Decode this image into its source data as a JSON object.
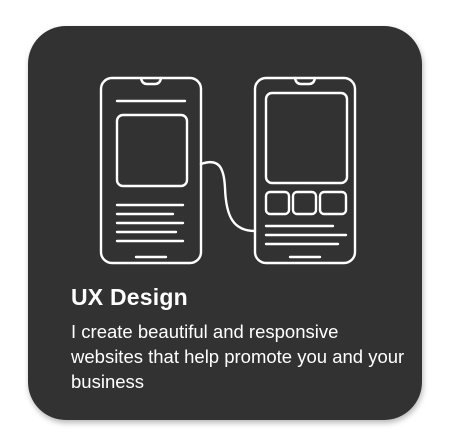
{
  "card": {
    "title": "UX Design",
    "description": "I create beautiful and responsive websites that help promote you and your business",
    "background_color": "#323232",
    "text_color": "#ffffff",
    "illustration_icon": "wireframe-phones-icon"
  }
}
